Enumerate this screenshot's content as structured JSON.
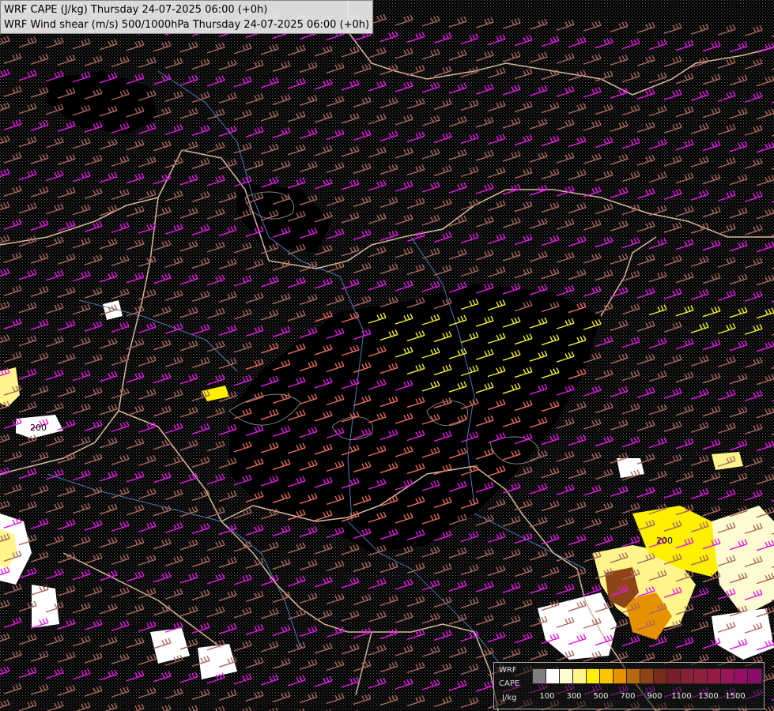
{
  "title": {
    "line1": "WRF CAPE (J/kg) Thursday 24-07-2025 06:00 (+0h)",
    "line2": "WRF Wind shear (m/s) 500/1000hPa Thursday 24-07-2025 06:00 (+0h)"
  },
  "legend": {
    "label_model": "WRF",
    "label_field": "CAPE",
    "label_unit": "J/kg",
    "colors": [
      "#7f7f7f",
      "#ffffff",
      "#fffbd0",
      "#fff58a",
      "#ffef00",
      "#ffc400",
      "#e69200",
      "#b86a12",
      "#8e4417",
      "#7a2a1a",
      "#7a1e2b",
      "#862235",
      "#8e1f3d",
      "#951a48",
      "#99155a",
      "#950f65",
      "#8a0d6a"
    ],
    "tick_labels": [
      "100",
      "300",
      "500",
      "700",
      "900",
      "1100",
      "1300",
      "1500"
    ]
  },
  "map_labels": [
    "200",
    "200"
  ],
  "colors": {
    "background": "#060606",
    "barb_low": "#a8675c",
    "barb_mid": "#e86b5e",
    "barb_magenta": "#e418e4",
    "barb_yellow": "#f5f02a",
    "border": "#d8b89a",
    "river": "#4c7ab6",
    "contour": "#9a9a9a"
  }
}
